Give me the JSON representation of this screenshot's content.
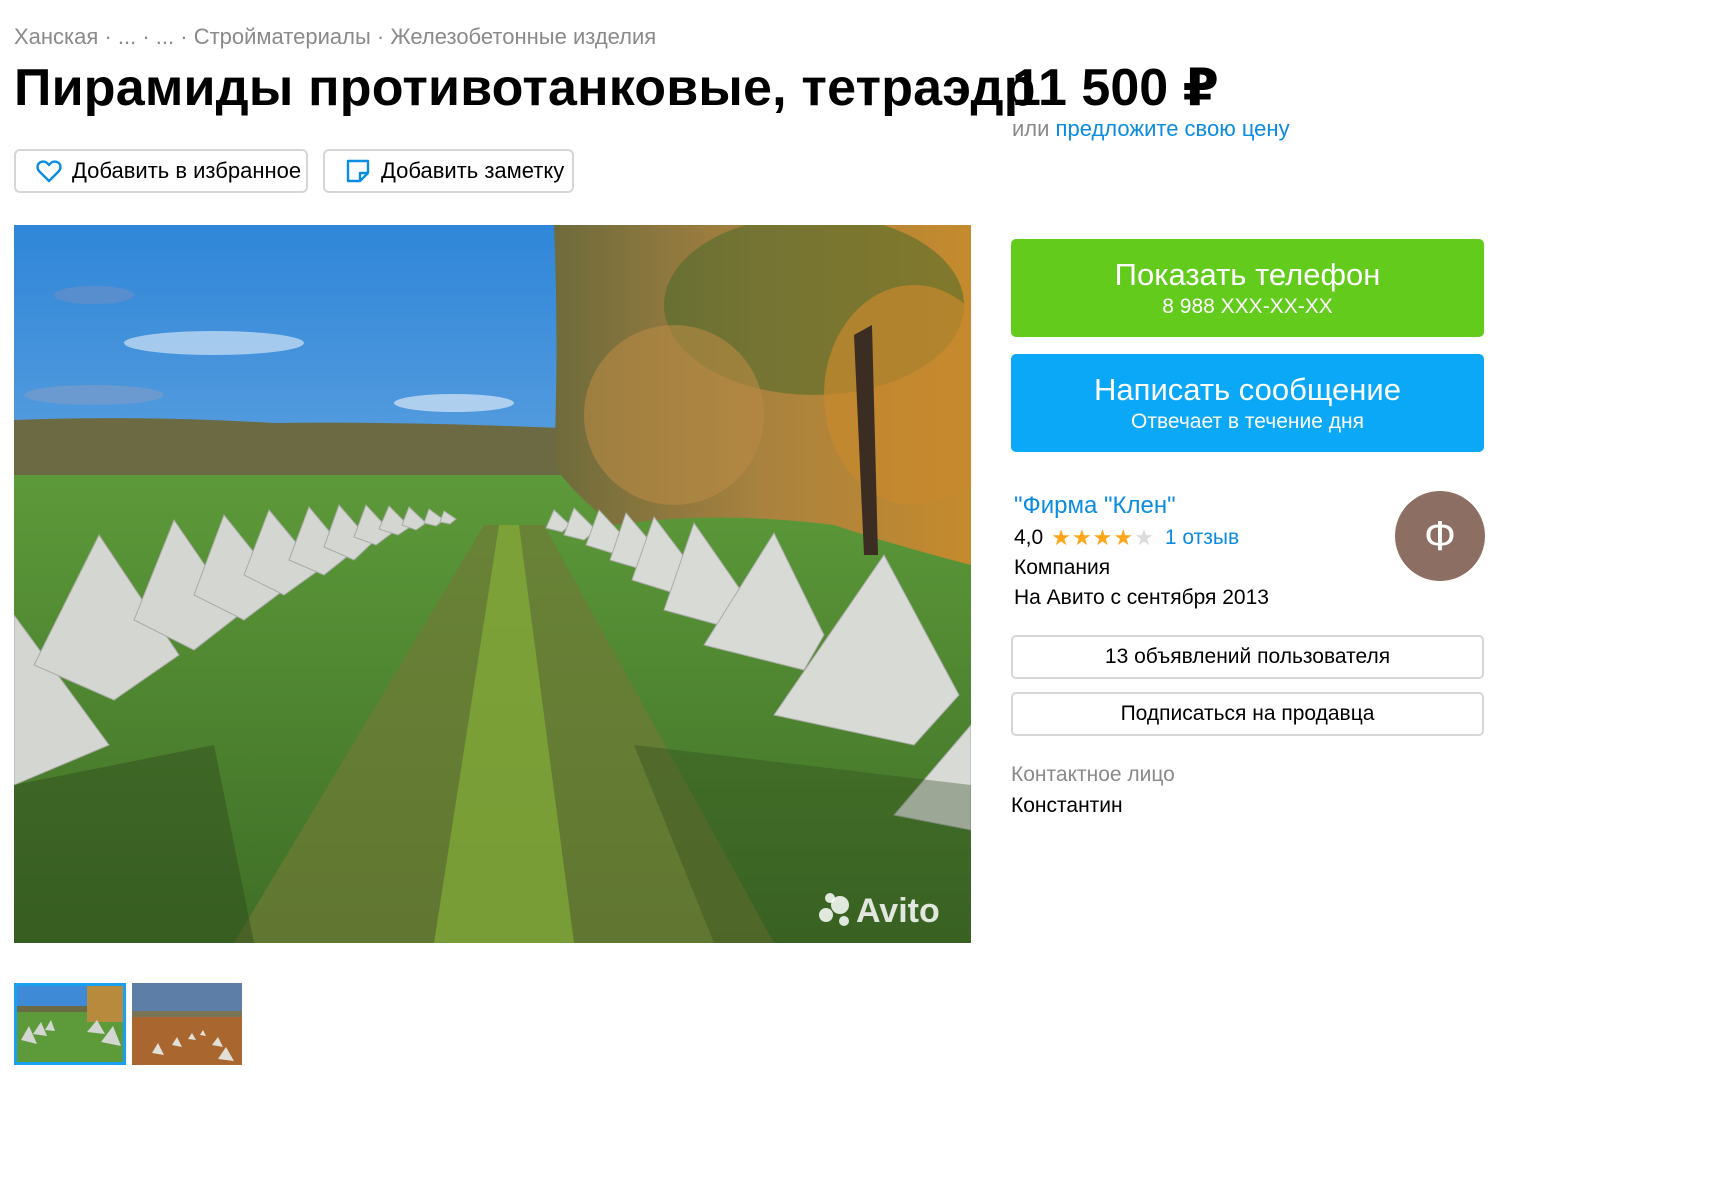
{
  "breadcrumb": {
    "items": [
      "Ханская",
      "...",
      "...",
      "Стройматериалы",
      "Железобетонные изделия"
    ],
    "separator": " · "
  },
  "listing": {
    "title": "Пирамиды противотанковые, тетраэдр",
    "price": "11 500 ₽",
    "offer_prefix": "или",
    "offer_link": "предложите свою цену"
  },
  "actions": {
    "favorite_label": "Добавить в избранное",
    "note_label": "Добавить заметку",
    "favorite_icon": "heart-icon",
    "note_icon": "note-icon"
  },
  "gallery": {
    "watermark": "Avito",
    "thumbnails": [
      "thumbnail-1",
      "thumbnail-2"
    ],
    "selected_index": 0
  },
  "contact": {
    "show_phone_label": "Показать телефон",
    "phone_masked": "8 988 XXX-XX-XX",
    "message_label": "Написать сообщение",
    "message_sub": "Отвечает в течение дня"
  },
  "seller": {
    "name": "\"Фирма \"Клен\"",
    "rating": "4,0",
    "rating_value": 4,
    "rating_max": 5,
    "reviews": "1 отзыв",
    "type": "Компания",
    "since": "На Авито с сентября 2013",
    "avatar_letter": "Ф",
    "listings_button": "13 объявлений пользователя",
    "subscribe_button": "Подписаться на продавца",
    "contact_person_label": "Контактное лицо",
    "contact_person_name": "Константин"
  },
  "colors": {
    "accent_link": "#0a8ce0",
    "phone_button": "#62cb1c",
    "message_button": "#0aa8f6",
    "avatar_bg": "#8d6e63",
    "star": "#ffa61a"
  }
}
